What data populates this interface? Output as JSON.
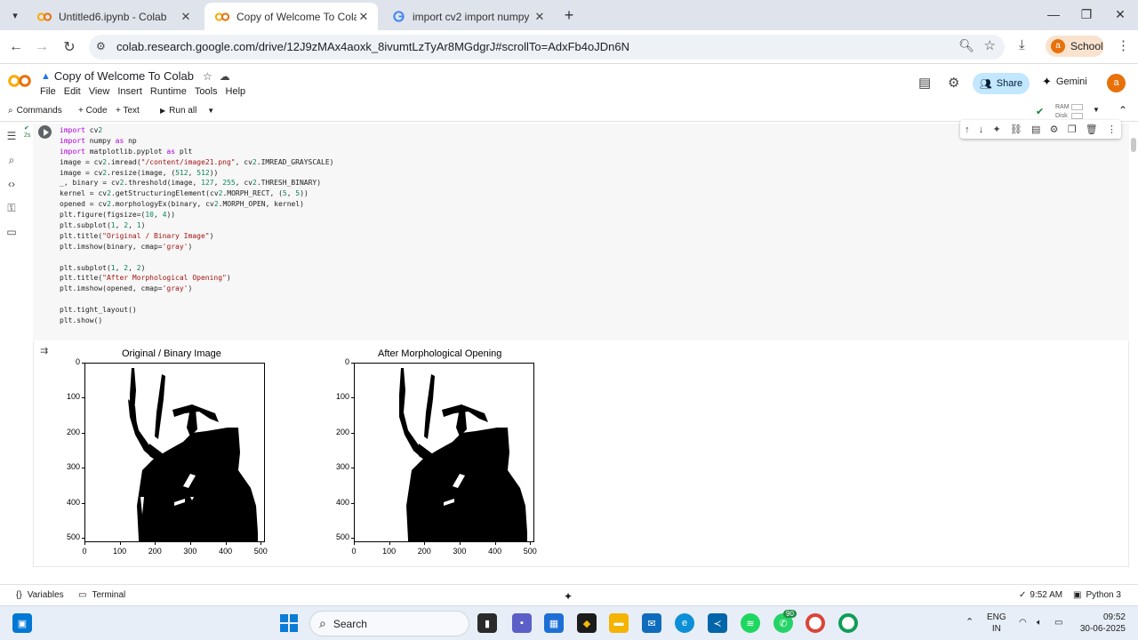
{
  "browser": {
    "tabs": [
      {
        "title": "Untitled6.ipynb - Colab",
        "active": false
      },
      {
        "title": "Copy of Welcome To Colab - Colab",
        "active": true
      },
      {
        "title": "import cv2 import numpy as np",
        "active": false
      }
    ],
    "url": "colab.research.google.com/drive/12J9zMAx4aoxk_8ivumtLzTyAr8MGdgrJ#scrollTo=AdxFb4oJDn6N",
    "profile_label": "School",
    "profile_initial": "a"
  },
  "colab": {
    "doc_title": "Copy of Welcome To Colab",
    "menu": [
      "File",
      "Edit",
      "View",
      "Insert",
      "Runtime",
      "Tools",
      "Help"
    ],
    "share_label": "Share",
    "gemini_label": "Gemini",
    "user_initial": "a",
    "toolbar": {
      "commands": "Commands",
      "code": "+ Code",
      "text": "+ Text",
      "run_all": "Run all",
      "ram": "RAM",
      "disk": "Disk"
    },
    "cell_exec": "2s"
  },
  "code_lines": [
    "import cv2",
    "import numpy as np",
    "import matplotlib.pyplot as plt",
    "image = cv2.imread(\"/content/image21.png\", cv2.IMREAD_GRAYSCALE)",
    "image = cv2.resize(image, (512, 512))",
    "_, binary = cv2.threshold(image, 127, 255, cv2.THRESH_BINARY)",
    "kernel = cv2.getStructuringElement(cv2.MORPH_RECT, (5, 5))",
    "opened = cv2.morphologyEx(binary, cv2.MORPH_OPEN, kernel)",
    "plt.figure(figsize=(10, 4))",
    "plt.subplot(1, 2, 1)",
    "plt.title(\"Original / Binary Image\")",
    "plt.imshow(binary, cmap='gray')",
    "",
    "plt.subplot(1, 2, 2)",
    "plt.title(\"After Morphological Opening\")",
    "plt.imshow(opened, cmap='gray')",
    "",
    "plt.tight_layout()",
    "plt.show()"
  ],
  "output": {
    "plots": [
      {
        "title": "Original / Binary Image"
      },
      {
        "title": "After Morphological Opening"
      }
    ],
    "y_ticks": [
      "0",
      "100",
      "200",
      "300",
      "400",
      "500"
    ],
    "x_ticks": [
      "0",
      "100",
      "200",
      "300",
      "400",
      "500"
    ]
  },
  "statusbar": {
    "variables": "Variables",
    "terminal": "Terminal",
    "time": "9:52 AM",
    "runtime": "Python 3"
  },
  "taskbar": {
    "search": "Search",
    "lang_top": "ENG",
    "lang_bottom": "IN",
    "clock_time": "09:52",
    "clock_date": "30-06-2025",
    "whatsapp_badge": "90"
  }
}
